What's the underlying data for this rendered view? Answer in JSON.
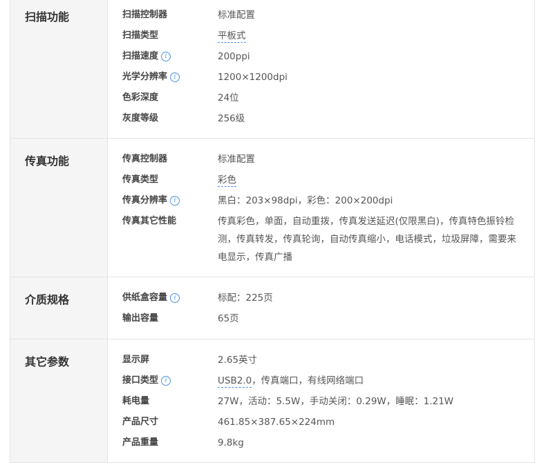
{
  "sections": [
    {
      "title": "扫描功能",
      "rows": [
        {
          "label": "扫描控制器",
          "value": "标准配置",
          "info": false
        },
        {
          "label": "扫描类型",
          "value": "平板式",
          "info": false,
          "dotted": true
        },
        {
          "label": "扫描速度",
          "value": "200ppi",
          "info": true
        },
        {
          "label": "光学分辨率",
          "value": "1200×1200dpi",
          "info": true
        },
        {
          "label": "色彩深度",
          "value": "24位",
          "info": false
        },
        {
          "label": "灰度等级",
          "value": "256级",
          "info": false
        }
      ]
    },
    {
      "title": "传真功能",
      "rows": [
        {
          "label": "传真控制器",
          "value": "标准配置",
          "info": false
        },
        {
          "label": "传真类型",
          "value": "彩色",
          "info": false,
          "dotted": true
        },
        {
          "label": "传真分辨率",
          "value": "黑白：203×98dpi，彩色：200×200dpi",
          "info": true
        },
        {
          "label": "传真其它性能",
          "value": "传真彩色，单面，自动重拨，传真发送延迟(仅限黑白)，传真特色振铃检测，传真转发，传真轮询，自动传真缩小，电话模式，垃圾屏障，需要来电显示，传真广播",
          "info": false,
          "multi": true
        }
      ]
    },
    {
      "title": "介质规格",
      "rows": [
        {
          "label": "供纸盒容量",
          "value": "标配：225页",
          "info": true
        },
        {
          "label": "输出容量",
          "value": "65页",
          "info": false
        }
      ]
    },
    {
      "title": "其它参数",
      "rows": [
        {
          "label": "显示屏",
          "value": "2.65英寸",
          "info": false
        },
        {
          "label": "接口类型",
          "value_parts": [
            "USB2.0",
            "，传真端口，有线网络端口"
          ],
          "info": true
        },
        {
          "label": "耗电量",
          "value": "27W，活动：5.5W，手动关闭：0.29W，睡眠：1.21W",
          "info": false
        },
        {
          "label": "产品尺寸",
          "value": "461.85×387.65×224mm",
          "info": false
        },
        {
          "label": "产品重量",
          "value": "9.8kg",
          "info": false
        }
      ]
    }
  ],
  "icons": {
    "info": "info-circle-icon",
    "info_glyph": "i",
    "accent_color": "#4a90e2"
  }
}
